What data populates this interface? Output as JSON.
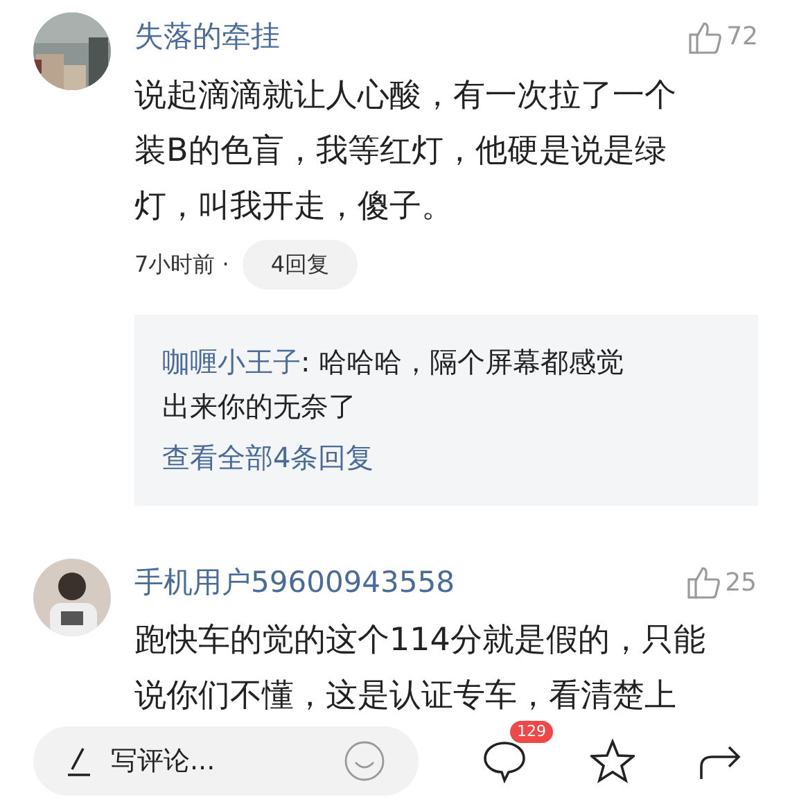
{
  "comments": [
    {
      "author": "失落的牵挂",
      "avatar": {
        "kind": "picture"
      },
      "likes": "72",
      "body_lines": [
        "说起滴滴就让人心酸，有一次拉了一个",
        "装B的色盲，我等红灯，他硬是说是绿",
        "灯，叫我开走，傻子。"
      ],
      "time": "7小时前 ·",
      "reply_count": "4回复",
      "replies": [
        {
          "author": "咖喱小王子",
          "text_lines": [
            ": 哈哈哈，隔个屏幕都感觉",
            "出来你的无奈了"
          ]
        }
      ],
      "view_all": "查看全部4条回复"
    },
    {
      "author": "手机用户59600943558",
      "avatar": {
        "kind": "picture"
      },
      "likes": "25",
      "body_lines": [
        "跑快车的觉的这个114分就是假的，只能",
        "说你们不懂，这是认证专车，看清楚上"
      ]
    }
  ],
  "bottom_bar": {
    "placeholder": "写评论...",
    "comment_badge": "129"
  }
}
